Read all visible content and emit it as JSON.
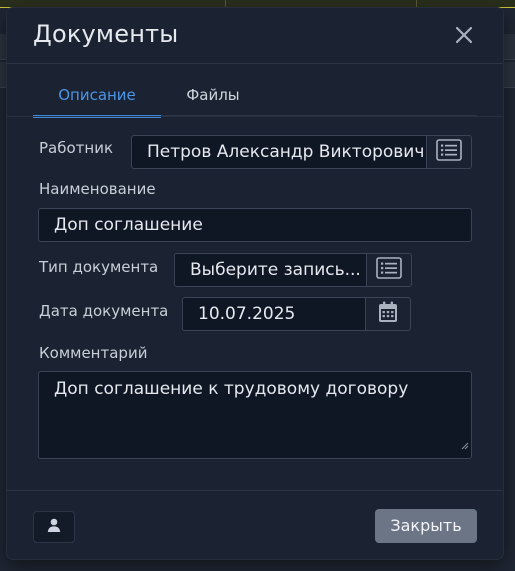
{
  "dialog": {
    "title": "Документы",
    "tabs": [
      {
        "label": "Описание",
        "active": true
      },
      {
        "label": "Файлы",
        "active": false
      }
    ]
  },
  "form": {
    "employee": {
      "label": "Работник",
      "value": "Петров Александр Викторович"
    },
    "name": {
      "label": "Наименование",
      "value": "Доп соглашение"
    },
    "doc_type": {
      "label": "Тип документа",
      "value": "Выберите запись..."
    },
    "doc_date": {
      "label": "Дата документа",
      "value": "10.07.2025"
    },
    "comment": {
      "label": "Комментарий",
      "value": "Доп соглашение к трудовому договору"
    }
  },
  "footer": {
    "close_label": "Закрыть"
  },
  "colors": {
    "accent": "#3d86d8",
    "modal_bg": "#1b2332",
    "input_bg": "#0f1624",
    "button_gray": "#6b7585"
  },
  "icons": {
    "close": "close-icon",
    "list": "list-icon",
    "calendar": "calendar-icon",
    "user": "user-icon"
  }
}
